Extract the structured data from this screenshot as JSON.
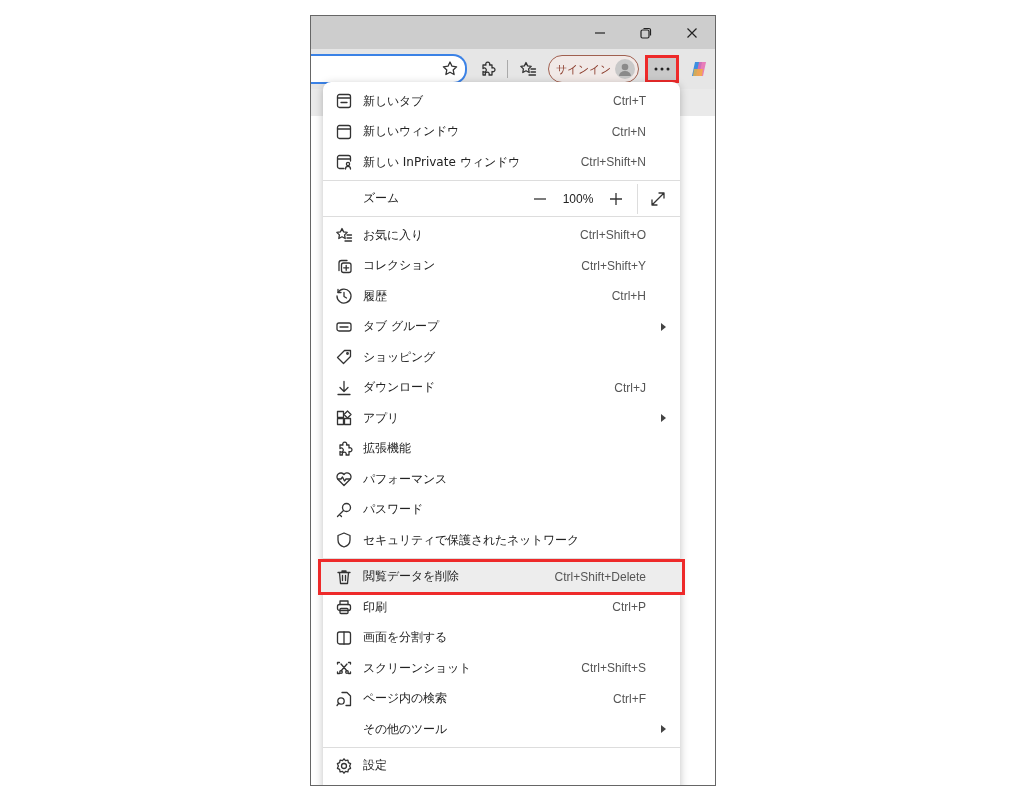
{
  "toolbar": {
    "sign_in": {
      "label": "サインイン"
    },
    "more_button": {
      "annotated": true
    }
  },
  "menu": {
    "sections": [
      {
        "items": [
          {
            "kind": "item",
            "label": "新しいタブ",
            "shortcut": "Ctrl+T",
            "submenu": false,
            "highlighted": false,
            "annotated": false
          },
          {
            "kind": "item",
            "label": "新しいウィンドウ",
            "shortcut": "Ctrl+N",
            "submenu": false,
            "highlighted": false,
            "annotated": false
          },
          {
            "kind": "item",
            "label": "新しい InPrivate ウィンドウ",
            "shortcut": "Ctrl+Shift+N",
            "submenu": false,
            "highlighted": false,
            "annotated": false
          }
        ]
      },
      {
        "items": [
          {
            "kind": "zoom",
            "label": "ズーム",
            "value": "100%"
          }
        ]
      },
      {
        "items": [
          {
            "kind": "item",
            "label": "お気に入り",
            "shortcut": "Ctrl+Shift+O",
            "submenu": false,
            "highlighted": false,
            "annotated": false
          },
          {
            "kind": "item",
            "label": "コレクション",
            "shortcut": "Ctrl+Shift+Y",
            "submenu": false,
            "highlighted": false,
            "annotated": false
          },
          {
            "kind": "item",
            "label": "履歴",
            "shortcut": "Ctrl+H",
            "submenu": false,
            "highlighted": false,
            "annotated": false
          },
          {
            "kind": "item",
            "label": "タブ グループ",
            "submenu": true,
            "highlighted": false,
            "annotated": false
          },
          {
            "kind": "item",
            "label": "ショッピング",
            "submenu": false,
            "highlighted": false,
            "annotated": false
          },
          {
            "kind": "item",
            "label": "ダウンロード",
            "shortcut": "Ctrl+J",
            "submenu": false,
            "highlighted": false,
            "annotated": false
          },
          {
            "kind": "item",
            "label": "アプリ",
            "submenu": true,
            "highlighted": false,
            "annotated": false
          },
          {
            "kind": "item",
            "label": "拡張機能",
            "submenu": false,
            "highlighted": false,
            "annotated": false
          },
          {
            "kind": "item",
            "label": "パフォーマンス",
            "submenu": false,
            "highlighted": false,
            "annotated": false
          },
          {
            "kind": "item",
            "label": "パスワード",
            "submenu": false,
            "highlighted": false,
            "annotated": false
          },
          {
            "kind": "item",
            "label": "セキュリティで保護されたネットワーク",
            "submenu": false,
            "highlighted": false,
            "annotated": false
          }
        ]
      },
      {
        "items": [
          {
            "kind": "item",
            "label": "閲覧データを削除",
            "shortcut": "Ctrl+Shift+Delete",
            "submenu": false,
            "highlighted": true,
            "annotated": true
          },
          {
            "kind": "item",
            "label": "印刷",
            "shortcut": "Ctrl+P",
            "submenu": false,
            "highlighted": false,
            "annotated": false
          },
          {
            "kind": "item",
            "label": "画面を分割する",
            "submenu": false,
            "highlighted": false,
            "annotated": false
          },
          {
            "kind": "item",
            "label": "スクリーンショット",
            "shortcut": "Ctrl+Shift+S",
            "submenu": false,
            "highlighted": false,
            "annotated": false
          },
          {
            "kind": "item",
            "label": "ページ内の検索",
            "shortcut": "Ctrl+F",
            "submenu": false,
            "highlighted": false,
            "annotated": false
          },
          {
            "kind": "item",
            "label": "その他のツール",
            "submenu": true,
            "highlighted": false,
            "annotated": false
          }
        ]
      },
      {
        "items": [
          {
            "kind": "item",
            "label": "設定",
            "submenu": false,
            "highlighted": false,
            "annotated": false
          }
        ]
      }
    ]
  }
}
